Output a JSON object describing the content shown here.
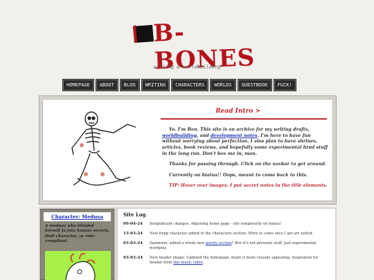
{
  "site": {
    "logo_text": "B-BONES",
    "tagline": "writing & worldbuilding"
  },
  "nav": [
    "HOMEPAGE",
    "ABOUT",
    "BLOG",
    "WRITING",
    "CHARACTERS",
    "WORLDS",
    "GUESTBOOK",
    "FUCK!"
  ],
  "intro": {
    "title": "Read Intro >",
    "p1_a": "Yo. I'm Ben. This site is an archive for my writing drafts, ",
    "p1_link1": "worldbuilding",
    "p1_b": ", and ",
    "p1_link2": "development notes",
    "p1_c": ". I'm here to have fun without worrying about perfection. I also plan to have shrines, articles, book reviews, and hopefully some experimental html stuff in the long run. Don't box me in, man.",
    "p2": "Thanks for passing through. Click on the navbar to get around.",
    "p3": "Currently on hiatus!! Oops, meant to come back to this.",
    "p4": "TIP: Hover over images. I put secret notes in the title elements."
  },
  "character": {
    "title": "Character: Medusa",
    "desc": "A medusa who blinded herself to join human society. DnD character, ye role-compliant."
  },
  "log": {
    "title": "Site Log.",
    "entries": [
      {
        "date": "09-04-24",
        "text": "Insignificant changes. Adjusting home page - site temporarily on hiatus!"
      },
      {
        "date": "13-03-24",
        "text": "New ttrpg character added to the characters section. More to come once I get art sorted."
      },
      {
        "date": "03-03-24",
        "text_a": "Dammmn, added a whole new ",
        "link": "poetry section",
        "text_b": "? Btw it's not personal stuff. Just experimental wordplay."
      },
      {
        "date": "03-03-24",
        "text_a": "New header image. Updated the homepage, made it more visually appealing. Inspiration for header from ",
        "link": "this music video",
        "text_b": "."
      }
    ]
  },
  "colors": {
    "accent": "#c0282e",
    "link": "#1a2fb0",
    "nav_bg": "#2b2b2b",
    "char_bg": "#a8f04a"
  }
}
